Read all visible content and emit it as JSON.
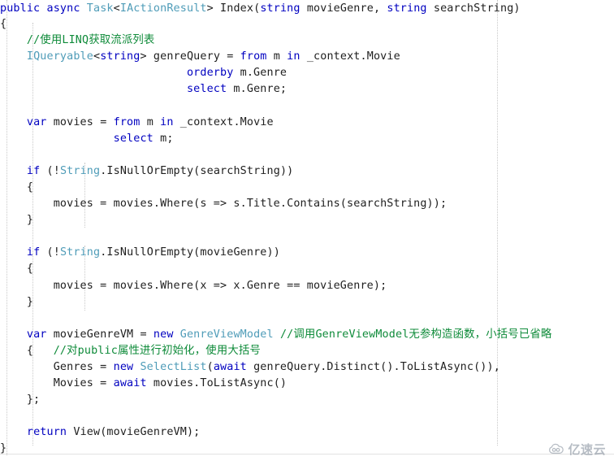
{
  "editor": {
    "language": "csharp",
    "background_color": "#ffffff",
    "guide_color": "#c9c9c9",
    "colors": {
      "keyword": "#0000c0",
      "type": "#4f9cb8",
      "comment": "#0f8b3a",
      "plain": "#202020"
    },
    "lines": [
      {
        "n": 1,
        "tokens": [
          {
            "t": "public",
            "c": "kw"
          },
          {
            "t": " ",
            "c": "pl"
          },
          {
            "t": "async",
            "c": "kw"
          },
          {
            "t": " ",
            "c": "pl"
          },
          {
            "t": "Task",
            "c": "type"
          },
          {
            "t": "<",
            "c": "pl"
          },
          {
            "t": "IActionResult",
            "c": "type"
          },
          {
            "t": "> Index(",
            "c": "pl"
          },
          {
            "t": "string",
            "c": "kw"
          },
          {
            "t": " movieGenre, ",
            "c": "pl"
          },
          {
            "t": "string",
            "c": "kw"
          },
          {
            "t": " searchString)",
            "c": "pl"
          }
        ]
      },
      {
        "n": 2,
        "tokens": [
          {
            "t": "{",
            "c": "pl"
          }
        ]
      },
      {
        "n": 3,
        "tokens": [
          {
            "t": "    ",
            "c": "pl"
          },
          {
            "t": "//使用LINQ获取流派列表",
            "c": "cmt"
          }
        ]
      },
      {
        "n": 4,
        "tokens": [
          {
            "t": "    ",
            "c": "pl"
          },
          {
            "t": "IQueryable",
            "c": "type"
          },
          {
            "t": "<",
            "c": "pl"
          },
          {
            "t": "string",
            "c": "kw"
          },
          {
            "t": "> genreQuery = ",
            "c": "pl"
          },
          {
            "t": "from",
            "c": "kw"
          },
          {
            "t": " m ",
            "c": "pl"
          },
          {
            "t": "in",
            "c": "kw"
          },
          {
            "t": " _context.Movie",
            "c": "pl"
          }
        ]
      },
      {
        "n": 5,
        "tokens": [
          {
            "t": "                            ",
            "c": "pl"
          },
          {
            "t": "orderby",
            "c": "kw"
          },
          {
            "t": " m.Genre",
            "c": "pl"
          }
        ]
      },
      {
        "n": 6,
        "tokens": [
          {
            "t": "                            ",
            "c": "pl"
          },
          {
            "t": "select",
            "c": "kw"
          },
          {
            "t": " m.Genre;",
            "c": "pl"
          }
        ]
      },
      {
        "n": 7,
        "tokens": [
          {
            "t": "",
            "c": "pl"
          }
        ]
      },
      {
        "n": 8,
        "tokens": [
          {
            "t": "    ",
            "c": "pl"
          },
          {
            "t": "var",
            "c": "kw"
          },
          {
            "t": " movies = ",
            "c": "pl"
          },
          {
            "t": "from",
            "c": "kw"
          },
          {
            "t": " m ",
            "c": "pl"
          },
          {
            "t": "in",
            "c": "kw"
          },
          {
            "t": " _context.Movie",
            "c": "pl"
          }
        ]
      },
      {
        "n": 9,
        "tokens": [
          {
            "t": "                 ",
            "c": "pl"
          },
          {
            "t": "select",
            "c": "kw"
          },
          {
            "t": " m;",
            "c": "pl"
          }
        ]
      },
      {
        "n": 10,
        "tokens": [
          {
            "t": "",
            "c": "pl"
          }
        ]
      },
      {
        "n": 11,
        "tokens": [
          {
            "t": "    ",
            "c": "pl"
          },
          {
            "t": "if",
            "c": "kw"
          },
          {
            "t": " (!",
            "c": "pl"
          },
          {
            "t": "String",
            "c": "type"
          },
          {
            "t": ".IsNullOrEmpty(searchString))",
            "c": "pl"
          }
        ]
      },
      {
        "n": 12,
        "tokens": [
          {
            "t": "    {",
            "c": "pl"
          }
        ]
      },
      {
        "n": 13,
        "tokens": [
          {
            "t": "        movies = movies.Where(s => s.Title.Contains(searchString));",
            "c": "pl"
          }
        ]
      },
      {
        "n": 14,
        "tokens": [
          {
            "t": "    }",
            "c": "pl"
          }
        ]
      },
      {
        "n": 15,
        "tokens": [
          {
            "t": "",
            "c": "pl"
          }
        ]
      },
      {
        "n": 16,
        "tokens": [
          {
            "t": "    ",
            "c": "pl"
          },
          {
            "t": "if",
            "c": "kw"
          },
          {
            "t": " (!",
            "c": "pl"
          },
          {
            "t": "String",
            "c": "type"
          },
          {
            "t": ".IsNullOrEmpty(movieGenre))",
            "c": "pl"
          }
        ]
      },
      {
        "n": 17,
        "tokens": [
          {
            "t": "    {",
            "c": "pl"
          }
        ]
      },
      {
        "n": 18,
        "tokens": [
          {
            "t": "        movies = movies.Where(x => x.Genre == movieGenre);",
            "c": "pl"
          }
        ]
      },
      {
        "n": 19,
        "tokens": [
          {
            "t": "    }",
            "c": "pl"
          }
        ]
      },
      {
        "n": 20,
        "tokens": [
          {
            "t": "",
            "c": "pl"
          }
        ]
      },
      {
        "n": 21,
        "tokens": [
          {
            "t": "    ",
            "c": "pl"
          },
          {
            "t": "var",
            "c": "kw"
          },
          {
            "t": " movieGenreVM = ",
            "c": "pl"
          },
          {
            "t": "new",
            "c": "kw"
          },
          {
            "t": " ",
            "c": "pl"
          },
          {
            "t": "GenreViewModel",
            "c": "type"
          },
          {
            "t": " ",
            "c": "pl"
          },
          {
            "t": "//调用GenreViewModel无参构造函数，小括号已省略",
            "c": "cmt"
          }
        ]
      },
      {
        "n": 22,
        "tokens": [
          {
            "t": "    {   ",
            "c": "pl"
          },
          {
            "t": "//对public属性进行初始化，使用大括号",
            "c": "cmt"
          }
        ]
      },
      {
        "n": 23,
        "tokens": [
          {
            "t": "        Genres = ",
            "c": "pl"
          },
          {
            "t": "new",
            "c": "kw"
          },
          {
            "t": " ",
            "c": "pl"
          },
          {
            "t": "SelectList",
            "c": "type"
          },
          {
            "t": "(",
            "c": "pl"
          },
          {
            "t": "await",
            "c": "kw"
          },
          {
            "t": " genreQuery.Distinct().ToListAsync()),",
            "c": "pl"
          }
        ]
      },
      {
        "n": 24,
        "tokens": [
          {
            "t": "        Movies = ",
            "c": "pl"
          },
          {
            "t": "await",
            "c": "kw"
          },
          {
            "t": " movies.ToListAsync()",
            "c": "pl"
          }
        ]
      },
      {
        "n": 25,
        "tokens": [
          {
            "t": "    };",
            "c": "pl"
          }
        ]
      },
      {
        "n": 26,
        "tokens": [
          {
            "t": "",
            "c": "pl"
          }
        ]
      },
      {
        "n": 27,
        "tokens": [
          {
            "t": "    ",
            "c": "pl"
          },
          {
            "t": "return",
            "c": "kw"
          },
          {
            "t": " View(movieGenreVM);",
            "c": "pl"
          }
        ]
      },
      {
        "n": 28,
        "tokens": [
          {
            "t": "}",
            "c": "pl"
          }
        ]
      }
    ]
  },
  "watermark": {
    "icon": "cloud-icon",
    "text": "亿速云",
    "color": "#7b8794"
  }
}
